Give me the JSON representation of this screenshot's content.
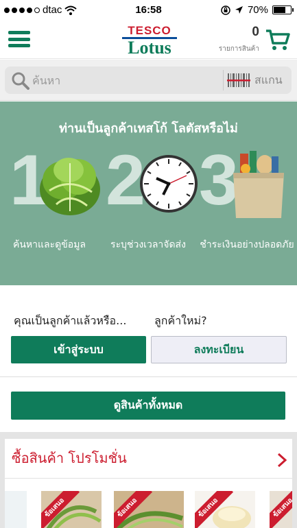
{
  "status_bar": {
    "carrier": "dtac",
    "time": "16:58",
    "battery": "70%",
    "battery_level": 0.7
  },
  "header": {
    "logo_top": "TESCO",
    "logo_bottom": "Lotus",
    "cart_count": "0",
    "cart_label": "รายการสินค้า"
  },
  "search": {
    "placeholder": "ค้นหา",
    "scan_label": "สแกน"
  },
  "hero": {
    "title": "ท่านเป็นลูกค้าเทสโก้ โลตัสหรือไม่",
    "steps": [
      {
        "number": "1",
        "label": "ค้นหาและดูข้อมูล"
      },
      {
        "number": "2",
        "label": "ระบุช่วงเวลาจัดส่ง"
      },
      {
        "number": "3",
        "label": "ชำระเงินอย่างปลอดภัย"
      }
    ]
  },
  "login": {
    "existing_question": "คุณเป็นลูกค้าแล้วหรือ...",
    "new_question": "ลูกค้าใหม่?",
    "login_button": "เข้าสู่ระบบ",
    "register_button": "ลงทะเบียน"
  },
  "view_all_button": "ดูสินค้าทั้งหมด",
  "promo": {
    "title": "ซื้อสินค้า โปรโมชั่น",
    "badge": "ข้อเสนอ"
  },
  "colors": {
    "brand_green": "#0f7c5a",
    "brand_red": "#cc1d2f",
    "hero_bg": "#7aab95"
  }
}
